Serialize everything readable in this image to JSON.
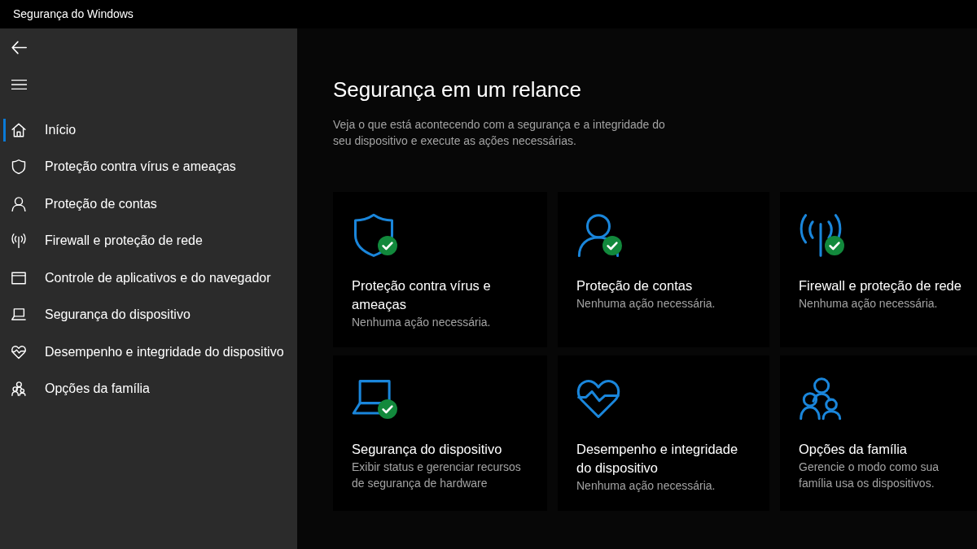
{
  "window": {
    "title": "Segurança do Windows"
  },
  "sidebar": {
    "items": [
      {
        "label": "Início",
        "selected": true
      },
      {
        "label": "Proteção contra vírus e ameaças",
        "selected": false
      },
      {
        "label": "Proteção de contas",
        "selected": false
      },
      {
        "label": "Firewall e proteção de rede",
        "selected": false
      },
      {
        "label": "Controle de aplicativos e do navegador",
        "selected": false
      },
      {
        "label": "Segurança do dispositivo",
        "selected": false
      },
      {
        "label": "Desempenho e integridade do dispositivo",
        "selected": false
      },
      {
        "label": "Opções da família",
        "selected": false
      }
    ]
  },
  "page": {
    "heading": "Segurança em um relance",
    "description": "Veja o que está acontecendo com a segurança e a integridade do seu dispositivo e execute as ações necessárias."
  },
  "cards": [
    {
      "title": "Proteção contra vírus e ameaças",
      "subtitle": "Nenhuma ação necessária.",
      "ok": true
    },
    {
      "title": "Proteção de contas",
      "subtitle": "Nenhuma ação necessária.",
      "ok": true
    },
    {
      "title": "Firewall e proteção de rede",
      "subtitle": "Nenhuma ação necessária.",
      "ok": true
    },
    {
      "title": "Segurança do dispositivo",
      "subtitle": "Exibir status e gerenciar recursos de segurança de hardware",
      "ok": true
    },
    {
      "title": "Desempenho e integridade do dispositivo",
      "subtitle": "Nenhuma ação necessária.",
      "ok": false
    },
    {
      "title": "Opções da família",
      "subtitle": "Gerencie o modo como sua família usa os dispositivos.",
      "ok": false
    }
  ]
}
